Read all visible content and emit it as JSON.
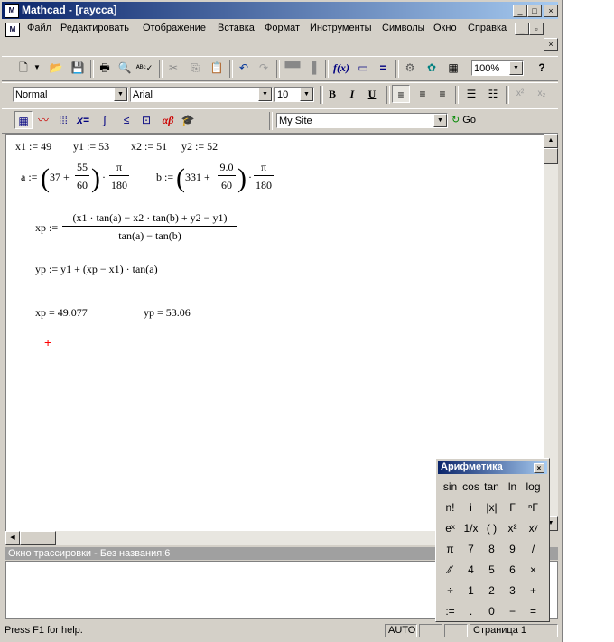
{
  "window": {
    "title": "Mathcad - [гаусса]",
    "caption_buttons": [
      "_",
      "□",
      "×"
    ],
    "doc_buttons": [
      "_",
      "▫",
      "×"
    ]
  },
  "menu": [
    {
      "label": "Файл"
    },
    {
      "label": "Редактировать"
    },
    {
      "label": "Отображение"
    },
    {
      "label": "Вставка"
    },
    {
      "label": "Формат"
    },
    {
      "label": "Инструменты"
    },
    {
      "label": "Символы"
    },
    {
      "label": "Окно"
    },
    {
      "label": "Справка"
    }
  ],
  "toolbar_standard": {
    "zoom": "100%",
    "icons": [
      "new-icon",
      "open-icon",
      "save-icon",
      "print-icon",
      "print-preview-icon",
      "spell-check-icon",
      "cut-icon",
      "copy-icon",
      "paste-icon",
      "undo-icon",
      "redo-icon",
      "align-horizontal-icon",
      "align-vertical-icon",
      "insert-function-icon",
      "insert-unit-icon",
      "calculate-icon",
      "insert-component-icon",
      "resource-center-icon",
      "table-icon",
      "help-icon"
    ]
  },
  "toolbar_format": {
    "style": "Normal",
    "font": "Arial",
    "size": "10",
    "bold": "B",
    "italic": "I",
    "underline": "U"
  },
  "toolbar_math": {
    "site": "My Site",
    "go_label": "Go"
  },
  "worksheet": {
    "line1": {
      "x1": "x1 := 49",
      "y1": "y1 := 53",
      "x2": "x2 := 51",
      "y2": "y2 := 52"
    },
    "a_def": {
      "lhs": "a :=",
      "int": "37 +",
      "num": "55",
      "den": "60",
      "dot": "·",
      "pi": "π",
      "pi_den": "180"
    },
    "b_def": {
      "lhs": "b :=",
      "int": "331 +",
      "num": "9.0",
      "den": "60",
      "dot": "·",
      "pi": "π",
      "pi_den": "180"
    },
    "xp_def": {
      "lhs": "xp :=",
      "num": "(x1 · tan(a) − x2 · tan(b) + y2 − y1)",
      "den": "tan(a) − tan(b)"
    },
    "yp_def": "yp := y1 + (xp − x1) · tan(a)",
    "xp_result": "xp = 49.077",
    "yp_result": "yp = 53.06",
    "cursor": "+"
  },
  "trace_window": {
    "title": "Окно трассировки - Без названия:6"
  },
  "status": {
    "help": "Press F1 for help.",
    "mode": "AUTO",
    "page": "Страница 1"
  },
  "palette": {
    "title": "Арифметика",
    "buttons": [
      "sin",
      "cos",
      "tan",
      "ln",
      "log",
      "n!",
      "i",
      "|x|",
      "Γ",
      "ⁿΓ",
      "eˣ",
      "1/x",
      "( )",
      "x²",
      "xʸ",
      "π",
      "7",
      "8",
      "9",
      "/",
      "⁄⁄",
      "4",
      "5",
      "6",
      "×",
      "÷",
      "1",
      "2",
      "3",
      "+",
      ":=",
      ".",
      "0",
      "−",
      "="
    ]
  },
  "colors": {
    "title_start": "#0a246a",
    "title_end": "#a6caf0",
    "cursor": "#ff0000"
  }
}
